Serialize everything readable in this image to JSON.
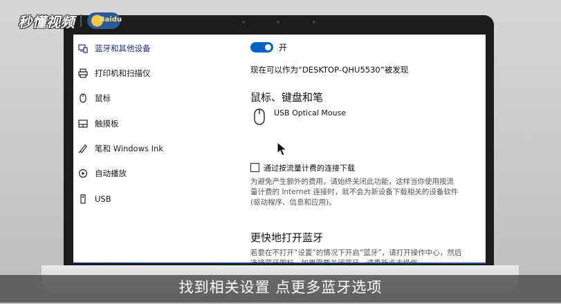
{
  "watermark": {
    "brand": "秒懂视频"
  },
  "sidebar": {
    "items": [
      {
        "label": "蓝牙和其他设备",
        "icon": "bluetooth-devices-icon",
        "active": true
      },
      {
        "label": "打印机和扫描仪",
        "icon": "printer-icon",
        "active": false
      },
      {
        "label": "鼠标",
        "icon": "mouse-icon",
        "active": false
      },
      {
        "label": "触摸板",
        "icon": "touchpad-icon",
        "active": false
      },
      {
        "label": "笔和 Windows Ink",
        "icon": "pen-icon",
        "active": false
      },
      {
        "label": "自动播放",
        "icon": "autoplay-icon",
        "active": false
      },
      {
        "label": "USB",
        "icon": "usb-icon",
        "active": false
      }
    ]
  },
  "bluetooth": {
    "toggle_state": "开",
    "toggle_on": true,
    "discoverable_text": "现在可以作为“DESKTOP-QHU5530”被发现"
  },
  "mouse_section": {
    "heading": "鼠标、键盘和笔",
    "device_name": "USB Optical Mouse"
  },
  "metered": {
    "checkbox_label": "通过按流量计费的连接下载",
    "checked": false,
    "description": [
      "为避免产生额外的费用，请始终关闭此功能，这样当你使用按流",
      "量计费的 Internet 连接时，就不会为新设备下载相关的设备软件",
      "(驱动程序、信息和应用)。"
    ]
  },
  "quick_bluetooth": {
    "heading": "更快地打开蓝牙",
    "description": [
      "若要在不打开“设置”的情况下开启“蓝牙”，请打开操作中心，然后",
      "选择蓝牙图标。如果需要关闭蓝牙，请重新点击操作。"
    ]
  },
  "caption": {
    "text": "找到相关设置 点更多蓝牙选项"
  },
  "colors": {
    "accent": "#0063c6",
    "active_nav": "#1f2f8f",
    "caption_bg": "#464646"
  }
}
